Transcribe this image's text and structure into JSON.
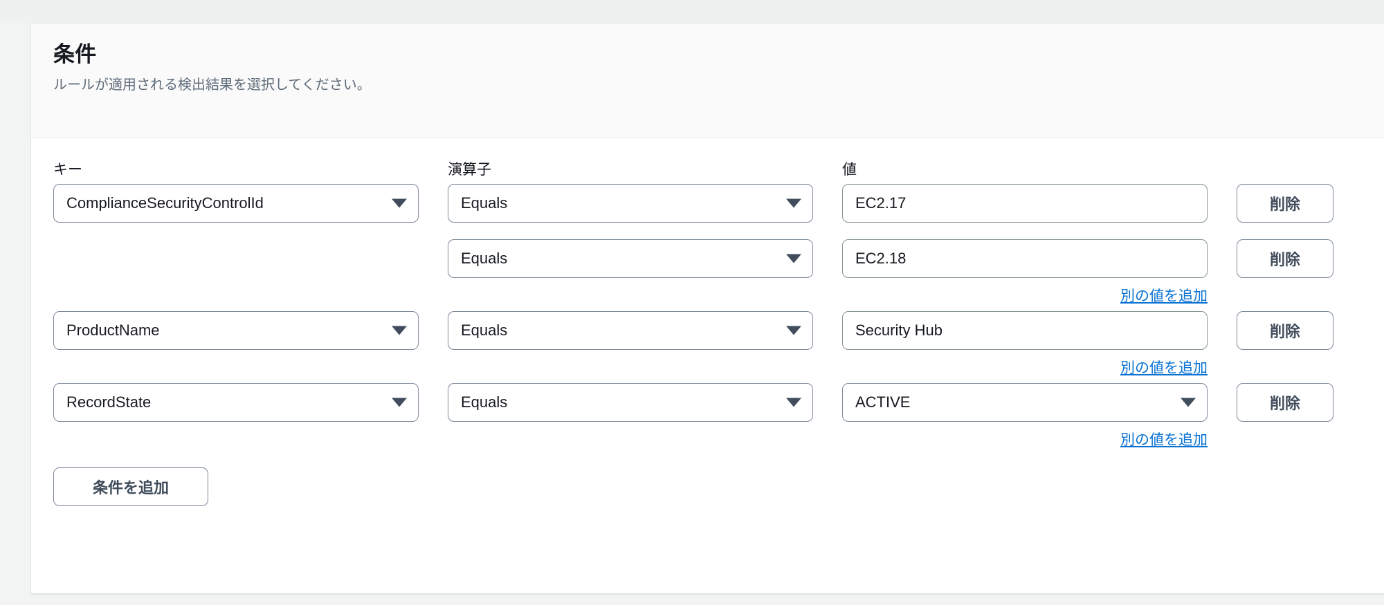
{
  "colors": {
    "page_background": "#f2f3f3",
    "card_background": "#ffffff",
    "card_header_background": "#fafafa",
    "link_accent": "#0972d3",
    "control_border": "#7d8998",
    "text_primary": "#16191f",
    "text_secondary": "#5f6b7a"
  },
  "card": {
    "title": "条件",
    "subtitle": "ルールが適用される検出結果を選択してください。"
  },
  "columns": {
    "key": "キー",
    "operator": "演算子",
    "value": "値",
    "actions": ""
  },
  "labels": {
    "delete": "削除",
    "add_another_value": "別の値を追加",
    "add_condition": "条件を追加",
    "caret": "chevron-down-icon"
  },
  "rows": [
    {
      "key": "ComplianceSecurityControlId",
      "key_visible": true,
      "key_type": "select",
      "operator": "Equals",
      "operator_type": "select",
      "value": "EC2.17",
      "value_type": "text",
      "delete": "削除",
      "add_another_value": false
    },
    {
      "key": "",
      "key_visible": false,
      "key_type": "select",
      "operator": "Equals",
      "operator_type": "select",
      "value": "EC2.18",
      "value_type": "text",
      "delete": "削除",
      "add_another_value": true
    },
    {
      "key": "ProductName",
      "key_visible": true,
      "key_type": "select",
      "operator": "Equals",
      "operator_type": "select",
      "value": "Security Hub",
      "value_type": "text",
      "delete": "削除",
      "add_another_value": true
    },
    {
      "key": "RecordState",
      "key_visible": true,
      "key_type": "select",
      "operator": "Equals",
      "operator_type": "select",
      "value": "ACTIVE",
      "value_type": "select",
      "delete": "削除",
      "add_another_value": true
    }
  ]
}
